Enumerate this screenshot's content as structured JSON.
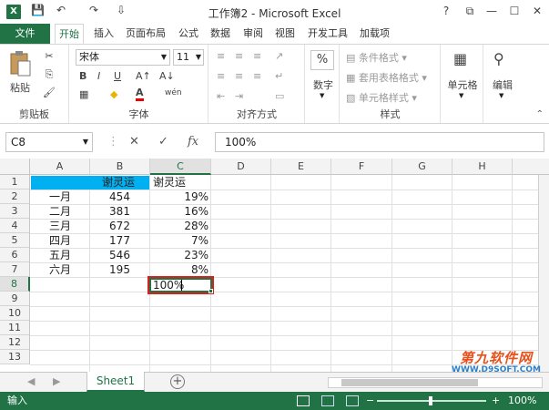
{
  "window": {
    "title": "工作簿2 - Microsoft Excel",
    "app_icon": "X",
    "help": "?",
    "restore": "⧉",
    "minimize": "—",
    "maximize": "☐",
    "close": "✕"
  },
  "quick_access": {
    "save": "💾",
    "undo": "↶",
    "redo": "↷",
    "customize": "⇩"
  },
  "ribbon_tabs": [
    "文件",
    "开始",
    "插入",
    "页面布局",
    "公式",
    "数据",
    "审阅",
    "视图",
    "开发工具",
    "加载项"
  ],
  "ribbon": {
    "clipboard": {
      "paste": "粘贴",
      "label": "剪贴板"
    },
    "font": {
      "name": "宋体",
      "size": "11",
      "bold": "B",
      "italic": "I",
      "underline": "U",
      "grow": "A↑",
      "shrink": "A↓",
      "color": "A",
      "phonetic": "wén",
      "label": "字体"
    },
    "alignment": {
      "label": "对齐方式"
    },
    "number": {
      "percent": "%",
      "label": "数字"
    },
    "styles": {
      "conditional": "条件格式",
      "table": "套用表格格式",
      "cell_styles": "单元格样式",
      "label": "样式"
    },
    "cells": {
      "label": "单元格"
    },
    "editing": {
      "label": "编辑"
    }
  },
  "formula_bar": {
    "name_box": "C8",
    "cancel": "✕",
    "enter": "✓",
    "fx": "fx",
    "value": "100%"
  },
  "columns": [
    "A",
    "B",
    "C",
    "D",
    "E",
    "F",
    "G",
    "H"
  ],
  "rows": [
    "1",
    "2",
    "3",
    "4",
    "5",
    "6",
    "7",
    "8",
    "9",
    "10",
    "11",
    "12",
    "13"
  ],
  "sheet": {
    "b1": "谢灵运",
    "c1": "谢灵运",
    "data": [
      {
        "month": "一月",
        "value": "454",
        "pct": "19%"
      },
      {
        "month": "二月",
        "value": "381",
        "pct": "16%"
      },
      {
        "month": "三月",
        "value": "672",
        "pct": "28%"
      },
      {
        "month": "四月",
        "value": "177",
        "pct": "7%"
      },
      {
        "month": "五月",
        "value": "546",
        "pct": "23%"
      },
      {
        "month": "六月",
        "value": "195",
        "pct": "8%"
      }
    ],
    "c8": "100%"
  },
  "sheet_tabs": {
    "active": "Sheet1",
    "add": "+",
    "prev": "◀",
    "next": "▶"
  },
  "status_bar": {
    "mode": "输入",
    "zoom": "100%",
    "zoom_out": "−",
    "zoom_in": "+"
  },
  "watermark": {
    "line1": "第九软件网",
    "line2": "WWW.D9SOFT.COM"
  },
  "colors": {
    "accent": "#217346",
    "header_fill": "#00b0f0",
    "highlight": "#d9201a"
  }
}
